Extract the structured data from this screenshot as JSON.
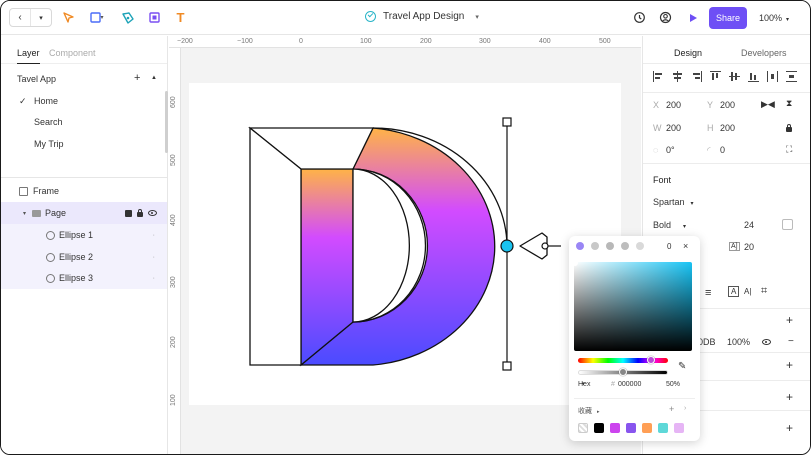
{
  "toolbar": {
    "back_glyph": "‹",
    "dropdown_glyph": "▾",
    "tools": [
      "select-tool-icon",
      "frame-tool-icon",
      "pen-tool-icon",
      "image-tool-icon",
      "text-tool-icon"
    ],
    "text_tool_glyph": "T",
    "document_title": "Travel App Design",
    "title_caret": "▾",
    "share_label": "Share",
    "zoom_label": "100%",
    "zoom_caret": "▾",
    "accent_color": "#6e4ff5"
  },
  "left_panel": {
    "tabs": [
      "Layer",
      "Component"
    ],
    "active_tab": "Layer",
    "pages_header": "Tavel App",
    "pages_add": "+",
    "pages_toggle": "▲",
    "check_glyph": "✓",
    "pages": [
      "Home",
      "Search",
      "My Trip"
    ],
    "current_page": "Home",
    "layers": {
      "frame": "Frame",
      "page": "Page",
      "page_caret": "▾",
      "ellipses": [
        "Ellipse 1",
        "Ellipse 2",
        "Ellipse 3"
      ],
      "dot": "·"
    }
  },
  "canvas": {
    "ruler_h": [
      "−200",
      "−100",
      "0",
      "100",
      "200",
      "300",
      "400",
      "500"
    ],
    "ruler_v": [
      "600",
      "500",
      "400",
      "300",
      "200",
      "100"
    ],
    "shape_gradient": [
      "#ffb347",
      "#d24bff",
      "#4b4bff"
    ],
    "anchor_color": "#19c3f0"
  },
  "right_panel": {
    "tabs": [
      "Design",
      "Developers"
    ],
    "active_tab": "Design",
    "position": {
      "x_label": "X",
      "x_value": "200",
      "y_label": "Y",
      "y_value": "200"
    },
    "size": {
      "w_label": "W",
      "w_value": "200",
      "h_label": "H",
      "h_value": "200"
    },
    "rotation": {
      "angle": "0°",
      "radius": "0"
    },
    "font": {
      "section_title": "Font",
      "family": "Spartan",
      "family_caret": "▾",
      "weight": "Bold",
      "weight_caret": "▾",
      "size": "24",
      "line_height_icon_label": "A]",
      "line_height": "20"
    },
    "fill": {
      "hex_partial": "0DB",
      "opacity": "100%"
    },
    "plus": "+",
    "text_icon_label": "A",
    "text_icon_label_2": "A|"
  },
  "color_picker": {
    "opacity_value": "0",
    "close_glyph": "×",
    "hex_mode_label": "Hex",
    "hex_mode_caret": "▾",
    "hex_value": "000000",
    "hex_prefix": "#",
    "alpha_percent": "50%",
    "swatch_section_label": "收藏",
    "swatch_section_caret": "▸",
    "swatch_add": "+",
    "swatch_next": "›",
    "dropper_glyph": "✎",
    "hue_fraction": 0.81,
    "alpha_fraction": 0.5,
    "type_colors": [
      "#9a86f5",
      "#c8c8c8",
      "#b8b8b8",
      "#bdbdbd",
      "#d9d9d9"
    ],
    "swatch_colors": [
      "#dddddd",
      "#000000",
      "#cc44ee",
      "#8855ee",
      "#ff9f55",
      "#5ed8d8",
      "#e6b5f5"
    ]
  }
}
